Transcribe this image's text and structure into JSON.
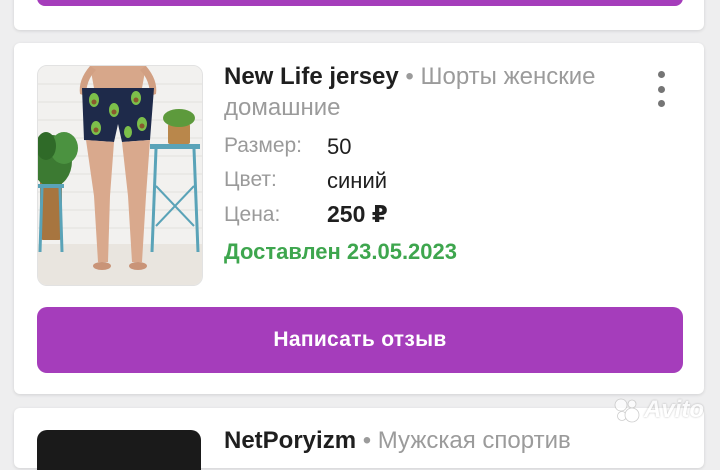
{
  "order_item": {
    "brand": "New Life jersey",
    "separator": "•",
    "category": "Шорты женские домашние",
    "properties": [
      {
        "label": "Размер:",
        "value": "50"
      },
      {
        "label": "Цвет:",
        "value": "синий"
      },
      {
        "label": "Цена:",
        "value": "250 ₽"
      }
    ],
    "status": "Доставлен 23.05.2023",
    "review_button": "Написать отзыв",
    "menu_icon": "more-vertical-icon"
  },
  "next_item": {
    "brand": "NetPoryizm",
    "separator": "•",
    "category": "Мужская спортив"
  },
  "watermark": "Avito",
  "colors": {
    "accent": "#a53dbb",
    "status_green": "#3ea64e",
    "muted_text": "#9a9a9a",
    "background": "#eeeeef"
  }
}
